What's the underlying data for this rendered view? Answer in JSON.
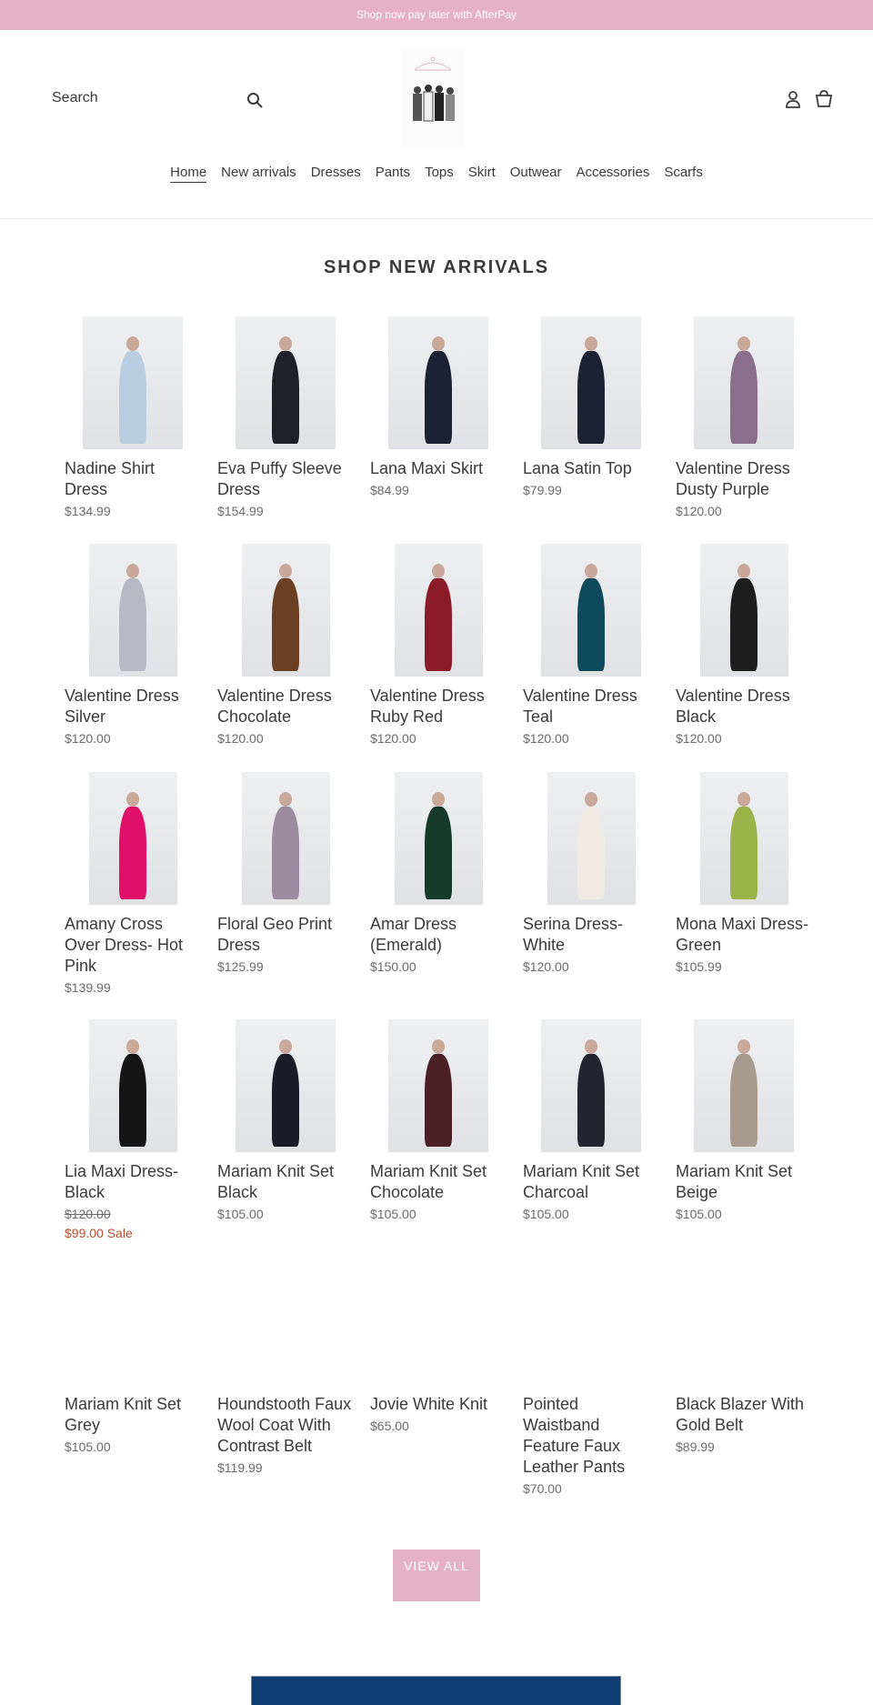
{
  "announcement": "Shop now pay later with AfterPay",
  "header": {
    "search_label": "Search",
    "icons": [
      "search-icon",
      "account-icon",
      "cart-icon"
    ]
  },
  "nav": [
    "Home",
    "New arrivals",
    "Dresses",
    "Pants",
    "Tops",
    "Skirt",
    "Outwear",
    "Accessories",
    "Scarfs"
  ],
  "section_title": "SHOP NEW ARRIVALS",
  "colors": {
    "accent": "#e5b1c4",
    "sale": "#b94a2a",
    "banner": "#0d3d72"
  },
  "products": [
    {
      "title": "Nadine Shirt Dress",
      "price": "$134.99",
      "color": "#b9cde0"
    },
    {
      "title": "Eva Puffy Sleeve Dress",
      "price": "$154.99",
      "color": "#1f2129"
    },
    {
      "title": "Lana Maxi Skirt",
      "price": "$84.99",
      "color": "#1c2233"
    },
    {
      "title": "Lana Satin Top",
      "price": "$79.99",
      "color": "#1c2233"
    },
    {
      "title": "Valentine Dress Dusty Purple",
      "price": "$120.00",
      "color": "#8a6f8c"
    },
    {
      "title": "Valentine Dress Silver",
      "price": "$120.00",
      "color": "#b7b9c2"
    },
    {
      "title": "Valentine Dress Chocolate",
      "price": "$120.00",
      "color": "#6b3f23"
    },
    {
      "title": "Valentine Dress Ruby Red",
      "price": "$120.00",
      "color": "#8c1b2a"
    },
    {
      "title": "Valentine Dress Teal",
      "price": "$120.00",
      "color": "#0f4a5c"
    },
    {
      "title": "Valentine Dress Black",
      "price": "$120.00",
      "color": "#1e1e1e"
    },
    {
      "title": "Amany Cross Over Dress- Hot Pink",
      "price": "$139.99",
      "color": "#e0106a"
    },
    {
      "title": "Floral Geo Print Dress",
      "price": "$125.99",
      "color": "#9b8aa0"
    },
    {
      "title": "Amar Dress (Emerald)",
      "price": "$150.00",
      "color": "#163a2a"
    },
    {
      "title": "Serina Dress- White",
      "price": "$120.00",
      "color": "#efebe4"
    },
    {
      "title": "Mona Maxi Dress- Green",
      "price": "$105.99",
      "color": "#9cb24a"
    },
    {
      "title": "Lia Maxi Dress- Black",
      "price": "$120.00",
      "sale_price": "$99.00 Sale",
      "color": "#151515"
    },
    {
      "title": "Mariam Knit Set Black",
      "price": "$105.00",
      "color": "#1a1c28"
    },
    {
      "title": "Mariam Knit Set Chocolate",
      "price": "$105.00",
      "color": "#4a1f26"
    },
    {
      "title": "Mariam Knit Set Charcoal",
      "price": "$105.00",
      "color": "#23262e"
    },
    {
      "title": "Mariam Knit Set Beige",
      "price": "$105.00",
      "color": "#a89a8c"
    },
    {
      "title": "Mariam Knit Set Grey",
      "price": "$105.00"
    },
    {
      "title": "Houndstooth Faux Wool Coat With Contrast Belt",
      "price": "$119.99"
    },
    {
      "title": "Jovie White Knit",
      "price": "$65.00"
    },
    {
      "title": "Pointed Waistband Feature Faux Leather Pants",
      "price": "$70.00"
    },
    {
      "title": "Black Blazer With Gold Belt",
      "price": "$89.99"
    }
  ],
  "view_all": "VIEW ALL"
}
